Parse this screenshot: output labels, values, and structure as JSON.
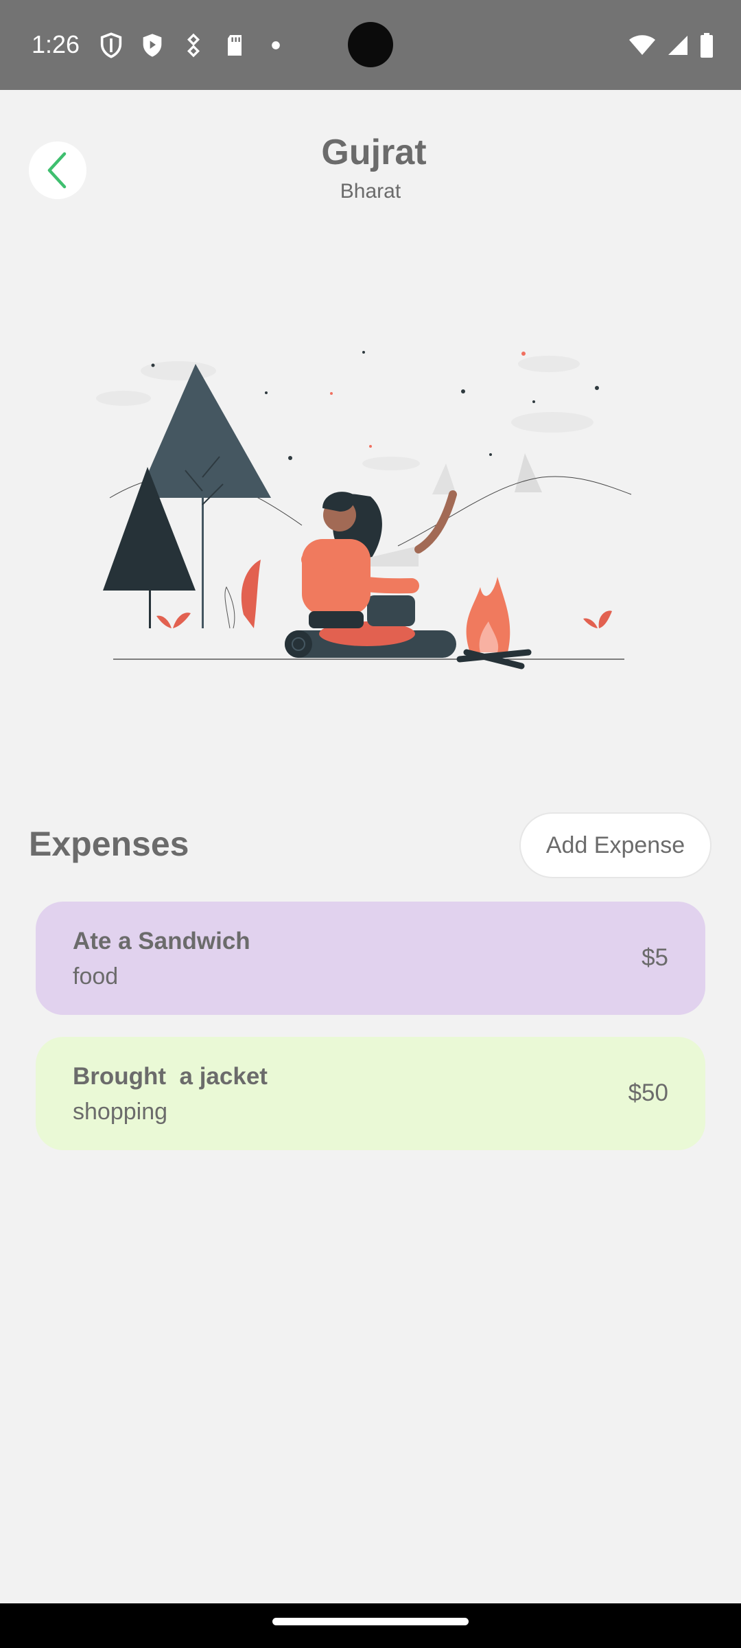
{
  "status_bar": {
    "time": "1:26",
    "left_icons": [
      "shield-icon",
      "play-protect-icon",
      "pin-icon",
      "sd-card-icon",
      "dot-icon"
    ],
    "right_icons": [
      "wifi-icon",
      "cell-signal-icon",
      "battery-icon"
    ]
  },
  "header": {
    "title": "Gujrat",
    "subtitle": "Bharat",
    "back_icon": "chevron-left-icon",
    "accent_color": "#3fbf6f"
  },
  "illustration": {
    "name": "couple-campfire-illustration"
  },
  "expenses": {
    "section_title": "Expenses",
    "add_button_label": "Add Expense",
    "items": [
      {
        "title": "Ate a Sandwich",
        "category": "food",
        "amount": "$5",
        "color": "#e1d2ee"
      },
      {
        "title": "Brought  a jacket",
        "category": "shopping",
        "amount": "$50",
        "color": "#eaf9d6"
      }
    ]
  }
}
